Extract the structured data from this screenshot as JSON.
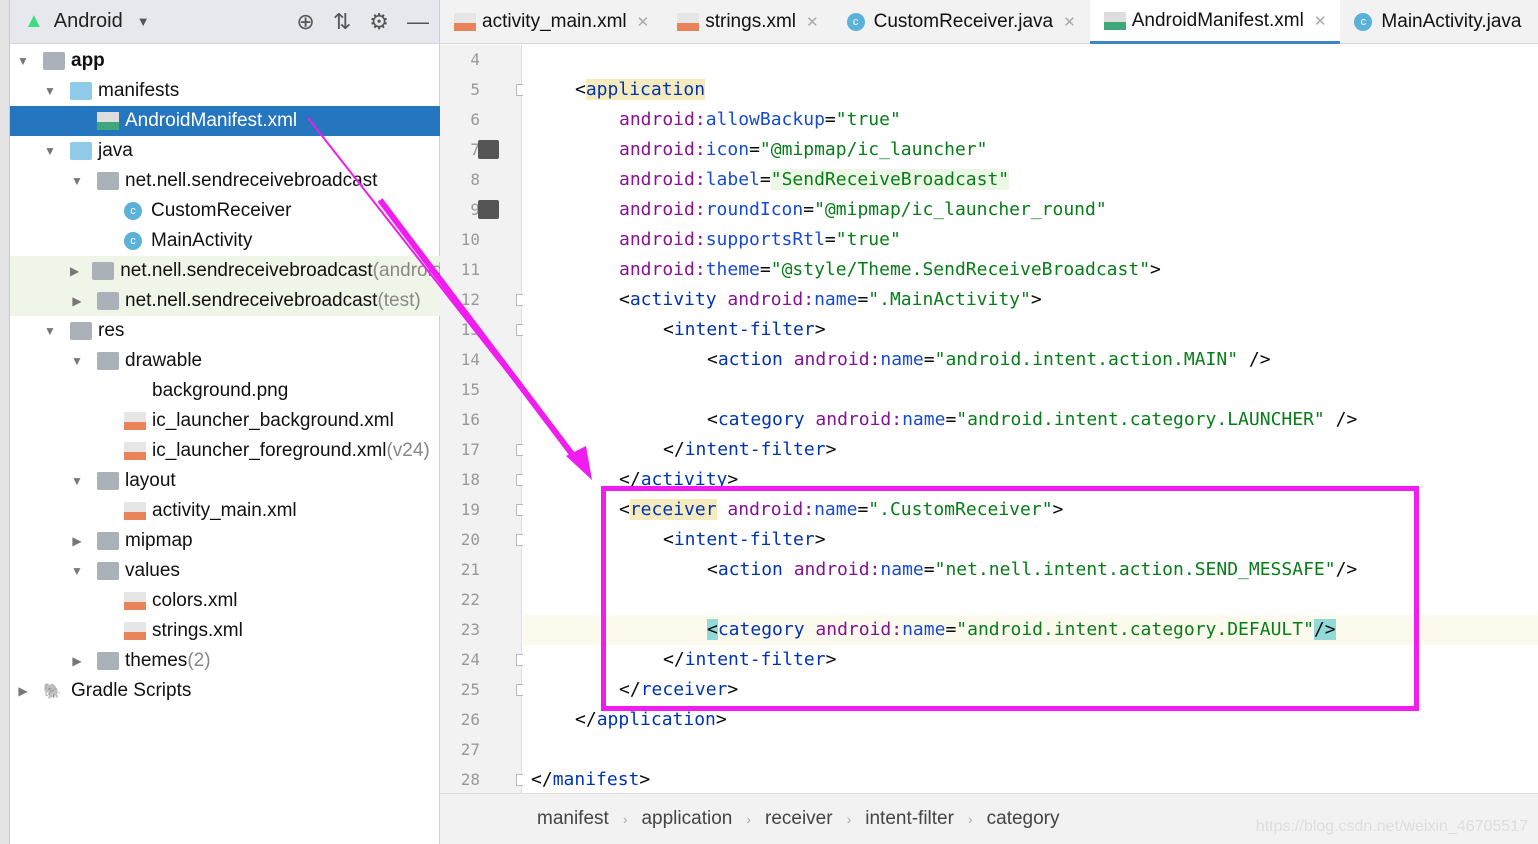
{
  "project": {
    "view": "Android",
    "tree": [
      {
        "label": "app",
        "level": 0,
        "icon": "module",
        "open": true,
        "bold": true
      },
      {
        "label": "manifests",
        "level": 1,
        "icon": "folder",
        "open": true
      },
      {
        "label": "AndroidManifest.xml",
        "level": 2,
        "icon": "manifest",
        "selected": true
      },
      {
        "label": "java",
        "level": 1,
        "icon": "folder",
        "open": true
      },
      {
        "label": "net.nell.sendreceivebroadcast",
        "level": 2,
        "icon": "package",
        "open": true
      },
      {
        "label": "CustomReceiver",
        "level": 3,
        "icon": "class"
      },
      {
        "label": "MainActivity",
        "level": 3,
        "icon": "class"
      },
      {
        "label": "net.nell.sendreceivebroadcast",
        "suffix": " (androidTest)",
        "level": 2,
        "icon": "package",
        "closed": true,
        "test": true
      },
      {
        "label": "net.nell.sendreceivebroadcast",
        "suffix": " (test)",
        "level": 2,
        "icon": "package",
        "closed": true,
        "test": true
      },
      {
        "label": "res",
        "level": 1,
        "icon": "res",
        "open": true
      },
      {
        "label": "drawable",
        "level": 2,
        "icon": "package",
        "open": true
      },
      {
        "label": "background.png",
        "level": 3,
        "icon": "none"
      },
      {
        "label": "ic_launcher_background.xml",
        "level": 3,
        "icon": "xml"
      },
      {
        "label": "ic_launcher_foreground.xml",
        "suffix": " (v24)",
        "level": 3,
        "icon": "xml"
      },
      {
        "label": "layout",
        "level": 2,
        "icon": "package",
        "open": true
      },
      {
        "label": "activity_main.xml",
        "level": 3,
        "icon": "xml"
      },
      {
        "label": "mipmap",
        "level": 2,
        "icon": "package",
        "closed": true
      },
      {
        "label": "values",
        "level": 2,
        "icon": "package",
        "open": true
      },
      {
        "label": "colors.xml",
        "level": 3,
        "icon": "xml"
      },
      {
        "label": "strings.xml",
        "level": 3,
        "icon": "xml"
      },
      {
        "label": "themes",
        "suffix": " (2)",
        "level": 3,
        "icon": "package",
        "closed": true,
        "shift": -1
      },
      {
        "label": "Gradle Scripts",
        "level": 0,
        "icon": "gradle",
        "closed": true
      }
    ]
  },
  "tabs": [
    {
      "label": "activity_main.xml",
      "icon": "xml"
    },
    {
      "label": "strings.xml",
      "icon": "xml"
    },
    {
      "label": "CustomReceiver.java",
      "icon": "class"
    },
    {
      "label": "AndroidManifest.xml",
      "icon": "manifest",
      "active": true
    },
    {
      "label": "MainActivity.java",
      "icon": "class"
    }
  ],
  "editor": {
    "current_line": 23,
    "lines": [
      {
        "n": 4,
        "indent": 0,
        "seg": []
      },
      {
        "n": 5,
        "indent": 1,
        "seg": [
          [
            "p",
            "<"
          ],
          [
            "tag",
            "application",
            "app"
          ]
        ]
      },
      {
        "n": 6,
        "indent": 2,
        "seg": [
          [
            "ns",
            "android:"
          ],
          [
            "attr",
            "allowBackup"
          ],
          [
            "p",
            "="
          ],
          [
            "val",
            "\"true\""
          ]
        ]
      },
      {
        "n": 7,
        "indent": 2,
        "img": true,
        "seg": [
          [
            "ns",
            "android:"
          ],
          [
            "attr",
            "icon"
          ],
          [
            "p",
            "="
          ],
          [
            "val",
            "\"@mipmap/ic_launcher\""
          ]
        ]
      },
      {
        "n": 8,
        "indent": 2,
        "seg": [
          [
            "ns",
            "android:"
          ],
          [
            "attr",
            "label"
          ],
          [
            "p",
            "="
          ],
          [
            "val",
            "\"SendReceiveBroadcast\"",
            "lab"
          ]
        ]
      },
      {
        "n": 9,
        "indent": 2,
        "img": true,
        "seg": [
          [
            "ns",
            "android:"
          ],
          [
            "attr",
            "roundIcon"
          ],
          [
            "p",
            "="
          ],
          [
            "val",
            "\"@mipmap/ic_launcher_round\""
          ]
        ]
      },
      {
        "n": 10,
        "indent": 2,
        "seg": [
          [
            "ns",
            "android:"
          ],
          [
            "attr",
            "supportsRtl"
          ],
          [
            "p",
            "="
          ],
          [
            "val",
            "\"true\""
          ]
        ]
      },
      {
        "n": 11,
        "indent": 2,
        "seg": [
          [
            "ns",
            "android:"
          ],
          [
            "attr",
            "theme"
          ],
          [
            "p",
            "="
          ],
          [
            "val",
            "\"@style/Theme.SendReceiveBroadcast\""
          ],
          [
            "p",
            ">"
          ]
        ]
      },
      {
        "n": 12,
        "indent": 2,
        "seg": [
          [
            "p",
            "<"
          ],
          [
            "tag",
            "activity "
          ],
          [
            "ns",
            "android:"
          ],
          [
            "attr",
            "name"
          ],
          [
            "p",
            "="
          ],
          [
            "val",
            "\".MainActivity\""
          ],
          [
            "p",
            ">"
          ]
        ]
      },
      {
        "n": 13,
        "indent": 3,
        "seg": [
          [
            "p",
            "<"
          ],
          [
            "tag",
            "intent-filter"
          ],
          [
            "p",
            ">"
          ]
        ]
      },
      {
        "n": 14,
        "indent": 4,
        "seg": [
          [
            "p",
            "<"
          ],
          [
            "tag",
            "action "
          ],
          [
            "ns",
            "android:"
          ],
          [
            "attr",
            "name"
          ],
          [
            "p",
            "="
          ],
          [
            "val",
            "\"android.intent.action.MAIN\""
          ],
          [
            "p",
            " />"
          ]
        ]
      },
      {
        "n": 15,
        "indent": 0,
        "seg": []
      },
      {
        "n": 16,
        "indent": 4,
        "seg": [
          [
            "p",
            "<"
          ],
          [
            "tag",
            "category "
          ],
          [
            "ns",
            "android:"
          ],
          [
            "attr",
            "name"
          ],
          [
            "p",
            "="
          ],
          [
            "val",
            "\"android.intent.category.LAUNCHER\""
          ],
          [
            "p",
            " />"
          ]
        ]
      },
      {
        "n": 17,
        "indent": 3,
        "seg": [
          [
            "p",
            "</"
          ],
          [
            "tag",
            "intent-filter"
          ],
          [
            "p",
            ">"
          ]
        ]
      },
      {
        "n": 18,
        "indent": 2,
        "seg": [
          [
            "p",
            "</"
          ],
          [
            "tag",
            "activity"
          ],
          [
            "p",
            ">"
          ]
        ]
      },
      {
        "n": 19,
        "indent": 2,
        "seg": [
          [
            "p",
            "<"
          ],
          [
            "tag",
            "receiver",
            "app"
          ],
          [
            "tag",
            " "
          ],
          [
            "ns",
            "android:"
          ],
          [
            "attr",
            "name"
          ],
          [
            "p",
            "="
          ],
          [
            "val",
            "\".CustomReceiver\""
          ],
          [
            "p",
            ">"
          ]
        ]
      },
      {
        "n": 20,
        "indent": 3,
        "seg": [
          [
            "p",
            "<"
          ],
          [
            "tag",
            "intent-filter"
          ],
          [
            "p",
            ">"
          ]
        ]
      },
      {
        "n": 21,
        "indent": 4,
        "seg": [
          [
            "p",
            "<"
          ],
          [
            "tag",
            "action "
          ],
          [
            "ns",
            "android:"
          ],
          [
            "attr",
            "name"
          ],
          [
            "p",
            "="
          ],
          [
            "val",
            "\"net.nell.intent.action.SEND_MESSAFE\""
          ],
          [
            "p",
            "/>"
          ]
        ]
      },
      {
        "n": 22,
        "indent": 0,
        "seg": []
      },
      {
        "n": 23,
        "indent": 4,
        "seg": [
          [
            "p",
            "<",
            "brace"
          ],
          [
            "tag",
            "category "
          ],
          [
            "ns",
            "android:"
          ],
          [
            "attr",
            "name"
          ],
          [
            "p",
            "="
          ],
          [
            "val",
            "\"android.intent.category.DEFAULT\""
          ],
          [
            "p",
            "/>",
            "brace"
          ]
        ]
      },
      {
        "n": 24,
        "indent": 3,
        "seg": [
          [
            "p",
            "</"
          ],
          [
            "tag",
            "intent-filter"
          ],
          [
            "p",
            ">"
          ]
        ]
      },
      {
        "n": 25,
        "indent": 2,
        "seg": [
          [
            "p",
            "</"
          ],
          [
            "tag",
            "receiver"
          ],
          [
            "p",
            ">"
          ]
        ]
      },
      {
        "n": 26,
        "indent": 1,
        "seg": [
          [
            "p",
            "</"
          ],
          [
            "tag",
            "application"
          ],
          [
            "p",
            ">"
          ]
        ]
      },
      {
        "n": 27,
        "indent": 0,
        "seg": []
      },
      {
        "n": 28,
        "indent": 0,
        "seg": [
          [
            "p",
            "</"
          ],
          [
            "tag",
            "manifest"
          ],
          [
            "p",
            ">"
          ]
        ]
      }
    ]
  },
  "breadcrumbs": [
    "manifest",
    "application",
    "receiver",
    "intent-filter",
    "category"
  ],
  "watermark": "https://blog.csdn.net/weixin_46705517",
  "annotation_color": "#f01cf0"
}
